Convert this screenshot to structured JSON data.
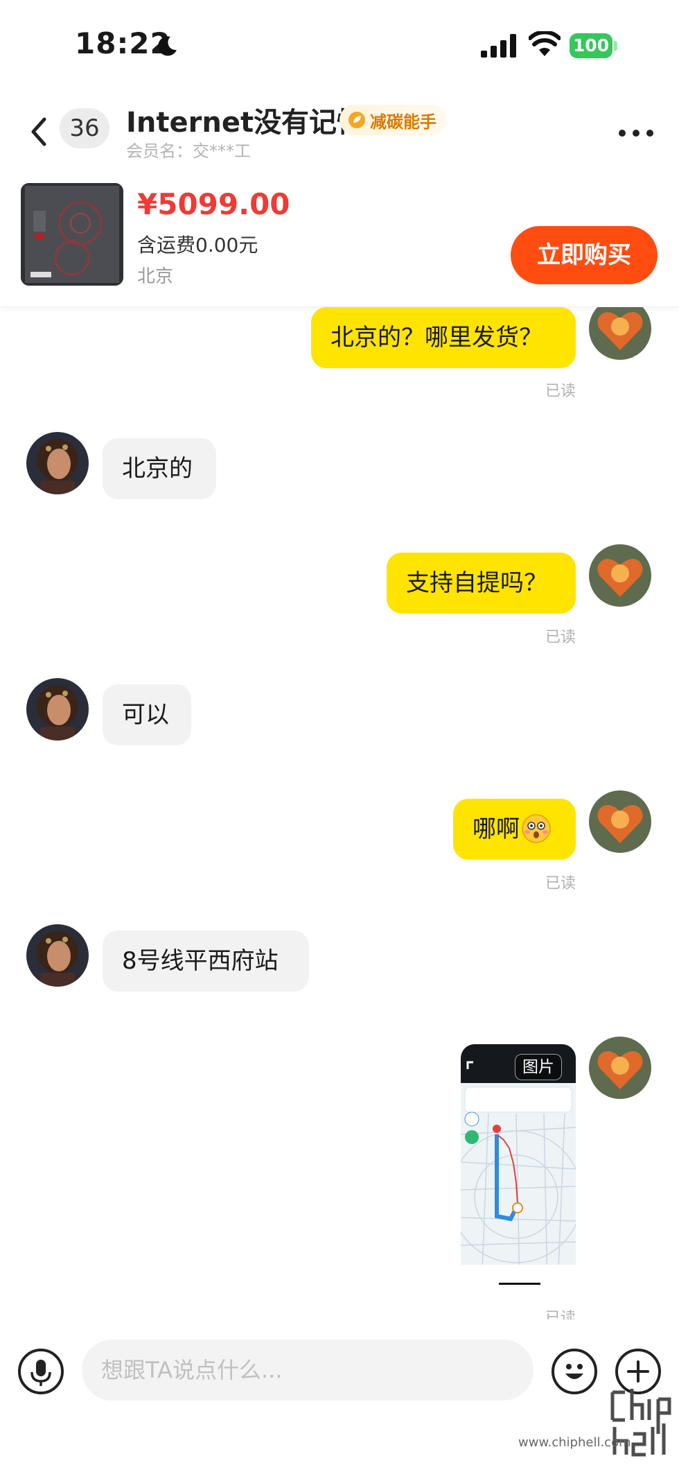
{
  "status_bar": {
    "time": "18:22",
    "battery": "100"
  },
  "header": {
    "unread_count": "36",
    "contact_name": "Internet没有记忆",
    "badge_label": "减碳能手",
    "member_name": "会员名：交***工"
  },
  "product": {
    "price": "¥5099.00",
    "shipping": "含运费0.00元",
    "location": "北京",
    "buy_label": "立即购买"
  },
  "messages": [
    {
      "side": "out",
      "text": "北京的？哪里发货？",
      "status": "已读"
    },
    {
      "side": "in",
      "text": "北京的"
    },
    {
      "side": "out",
      "text": "支持自提吗？",
      "status": "已读"
    },
    {
      "side": "in",
      "text": "可以"
    },
    {
      "side": "out",
      "text": "哪啊",
      "emoji": "flushed-face-emoji",
      "status": "已读"
    },
    {
      "side": "in",
      "text": "8号线平西府站"
    },
    {
      "side": "out",
      "type": "image",
      "image_tag": "图片",
      "status": "已读"
    }
  ],
  "input": {
    "placeholder": "想跟TA说点什么..."
  },
  "watermark": {
    "url": "www.chiphell.com"
  },
  "colors": {
    "outgoing_bubble": "#ffe400",
    "incoming_bubble": "#f2f2f2",
    "buy_button": "#ff4d12",
    "price": "#ee3b34",
    "badge_text": "#d97a00",
    "battery": "#34c759"
  }
}
